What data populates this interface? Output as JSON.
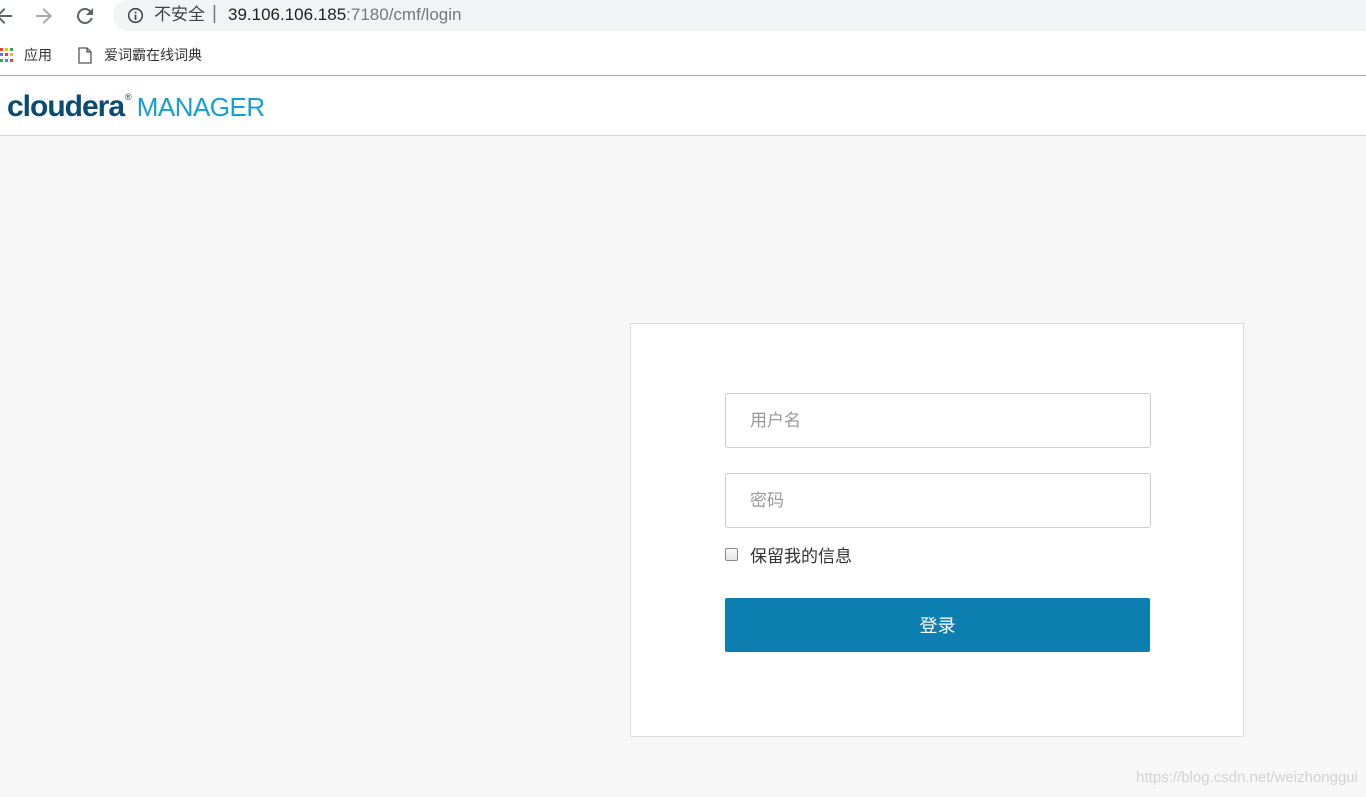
{
  "browser": {
    "insecure_label": "不安全",
    "separator": "|",
    "url_host": "39.106.106.185",
    "url_path": ":7180/cmf/login",
    "bookmarks": [
      {
        "label": "应用",
        "icon": "apps-grid-icon"
      },
      {
        "label": "爱词霸在线词典",
        "icon": "page-icon"
      }
    ],
    "apps_icon_colors": [
      "#ea4335",
      "#fbbc05",
      "#34a853",
      "#4285f4",
      "#ea4335",
      "#fbbc05",
      "#34a853",
      "#4285f4",
      "#ea4335"
    ]
  },
  "header": {
    "logo_brand": "cloudera",
    "logo_mark": "®",
    "logo_product": "MANAGER"
  },
  "login": {
    "username_placeholder": "用户名",
    "password_placeholder": "密码",
    "remember_label": "保留我的信息",
    "submit_label": "登录"
  },
  "watermark": "https://blog.csdn.net/weizhonggui",
  "colors": {
    "brand_dark": "#0a4b72",
    "brand_light": "#14a0d4",
    "button": "#0c7fb0"
  }
}
